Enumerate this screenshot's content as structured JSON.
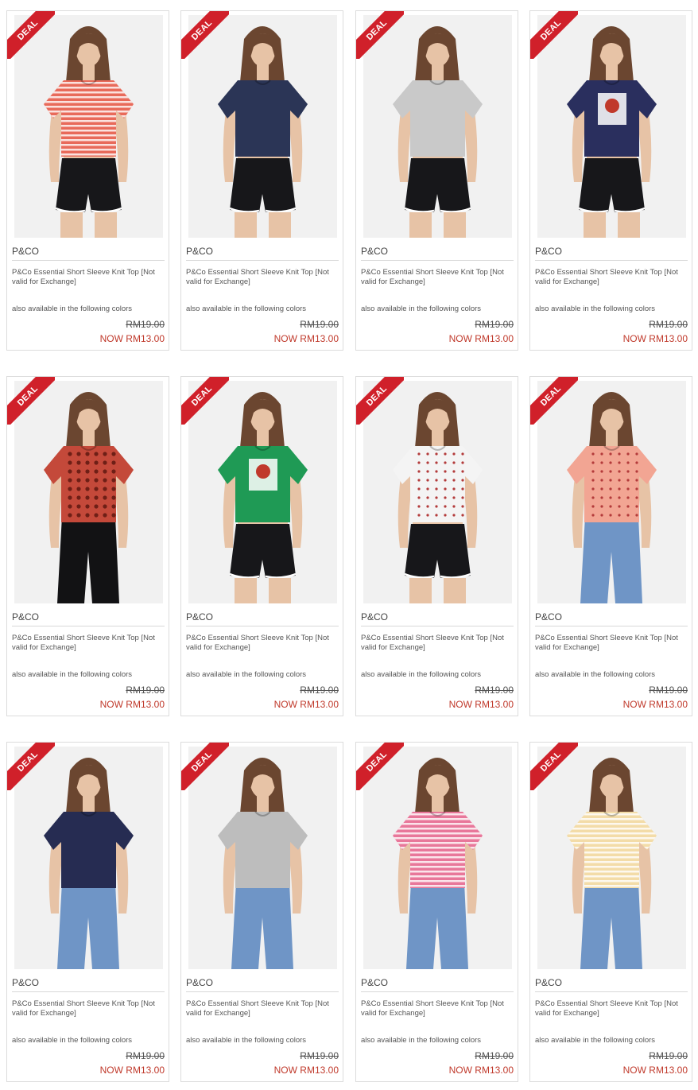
{
  "colors": {
    "deal_ribbon": "#d0202a",
    "sale_price": "#c0392b",
    "border": "#dcdcdc"
  },
  "products": [
    {
      "deal_label": "DEAL",
      "brand": "P&CO",
      "name": "P&Co Essential Short Sleeve Knit Top [Not valid for Exchange]",
      "colors_note": "also available in the following colors",
      "original_price": "RM19.00",
      "sale_price": "NOW RM13.00",
      "top_color": "#e86a5a",
      "top_pattern": "stripe",
      "bottom": "shorts"
    },
    {
      "deal_label": "DEAL",
      "brand": "P&CO",
      "name": "P&Co Essential Short Sleeve Knit Top [Not valid for Exchange]",
      "colors_note": "also available in the following colors",
      "original_price": "RM19.00",
      "sale_price": "NOW RM13.00",
      "top_color": "#2b3556",
      "top_pattern": "plain",
      "bottom": "shorts"
    },
    {
      "deal_label": "DEAL",
      "brand": "P&CO",
      "name": "P&Co Essential Short Sleeve Knit Top [Not valid for Exchange]",
      "colors_note": "also available in the following colors",
      "original_price": "RM19.00",
      "sale_price": "NOW RM13.00",
      "top_color": "#c9c9c9",
      "top_pattern": "plain",
      "bottom": "shorts"
    },
    {
      "deal_label": "DEAL",
      "brand": "P&CO",
      "name": "P&Co Essential Short Sleeve Knit Top [Not valid for Exchange]",
      "colors_note": "also available in the following colors",
      "original_price": "RM19.00",
      "sale_price": "NOW RM13.00",
      "top_color": "#2a2f5e",
      "top_pattern": "print",
      "bottom": "shorts"
    },
    {
      "deal_label": "DEAL",
      "brand": "P&CO",
      "name": "P&Co Essential Short Sleeve Knit Top [Not valid for Exchange]",
      "colors_note": "also available in the following colors",
      "original_price": "RM19.00",
      "sale_price": "NOW RM13.00",
      "top_color": "#c4493a",
      "top_pattern": "leopard",
      "bottom": "jeans-black"
    },
    {
      "deal_label": "DEAL",
      "brand": "P&CO",
      "name": "P&Co Essential Short Sleeve Knit Top [Not valid for Exchange]",
      "colors_note": "also available in the following colors",
      "original_price": "RM19.00",
      "sale_price": "NOW RM13.00",
      "top_color": "#1f9a55",
      "top_pattern": "print",
      "bottom": "shorts"
    },
    {
      "deal_label": "DEAL",
      "brand": "P&CO",
      "name": "P&Co Essential Short Sleeve Knit Top [Not valid for Exchange]",
      "colors_note": "also available in the following colors",
      "original_price": "RM19.00",
      "sale_price": "NOW RM13.00",
      "top_color": "#f4f4f4",
      "top_pattern": "dots",
      "bottom": "shorts"
    },
    {
      "deal_label": "DEAL",
      "brand": "P&CO",
      "name": "P&Co Essential Short Sleeve Knit Top [Not valid for Exchange]",
      "colors_note": "also available in the following colors",
      "original_price": "RM19.00",
      "sale_price": "NOW RM13.00",
      "top_color": "#f2a593",
      "top_pattern": "dots",
      "bottom": "jeans"
    },
    {
      "deal_label": "DEAL",
      "brand": "P&CO",
      "name": "P&Co Essential Short Sleeve Knit Top [Not valid for Exchange]",
      "colors_note": "also available in the following colors",
      "original_price": "RM19.00",
      "sale_price": "NOW RM13.00",
      "top_color": "#262c52",
      "top_pattern": "plain",
      "bottom": "jeans"
    },
    {
      "deal_label": "DEAL",
      "brand": "P&CO",
      "name": "P&Co Essential Short Sleeve Knit Top [Not valid for Exchange]",
      "colors_note": "also available in the following colors",
      "original_price": "RM19.00",
      "sale_price": "NOW RM13.00",
      "top_color": "#bdbdbd",
      "top_pattern": "plain",
      "bottom": "jeans"
    },
    {
      "deal_label": "DEAL",
      "brand": "P&CO",
      "name": "P&Co Essential Short Sleeve Knit Top [Not valid for Exchange]",
      "colors_note": "also available in the following colors",
      "original_price": "RM19.00",
      "sale_price": "NOW RM13.00",
      "top_color": "#e8779a",
      "top_pattern": "stripe",
      "bottom": "jeans"
    },
    {
      "deal_label": "DEAL",
      "brand": "P&CO",
      "name": "P&Co Essential Short Sleeve Knit Top [Not valid for Exchange]",
      "colors_note": "also available in the following colors",
      "original_price": "RM19.00",
      "sale_price": "NOW RM13.00",
      "top_color": "#f3dca8",
      "top_pattern": "stripe",
      "bottom": "jeans"
    }
  ]
}
